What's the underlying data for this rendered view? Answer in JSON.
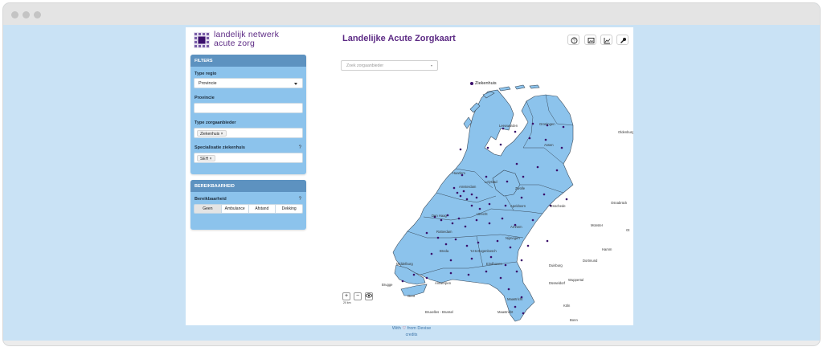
{
  "logo": {
    "line1": "landelijk netwerk",
    "line2": "acute zorg"
  },
  "app_title": "Landelijke Acute Zorgkaart",
  "filters": {
    "header": "FILTERS",
    "type_regio_label": "Type regio",
    "type_regio_value": "Provincie",
    "provincie_label": "Provincie",
    "provincie_value": "",
    "type_zorgaanbieder_label": "Type zorgaanbieder",
    "type_zorgaanbieder_tag": "Ziekenhuis",
    "specialisatie_label": "Specialisatie ziekenhuis",
    "specialisatie_tag": "SEH",
    "tag_remove": "×"
  },
  "bereikbaarheid": {
    "header": "BEREIKBAARHEID",
    "label": "Bereikbaarheid",
    "options": [
      "Geen",
      "Ambulance",
      "Afstand",
      "Dekking"
    ],
    "selected": "Geen"
  },
  "info_glyph": "?",
  "search": {
    "placeholder": "Zoek zorgaanbieder"
  },
  "legend": {
    "label": "Ziekenhuis",
    "color": "#3a0f6b"
  },
  "toolbar_icons": [
    "help-icon",
    "image-icon",
    "chart-icon",
    "wrench-icon"
  ],
  "map": {
    "land_color": "#8cc3ec",
    "cities_nl": [
      "Leeuwarden",
      "Groningen",
      "Assen",
      "Zwolle",
      "Lelystad",
      "Haarlem",
      "Amsterdam",
      "Utrecht",
      "Den Haag",
      "Rotterdam",
      "Arnhem",
      "Apeldoorn",
      "Enschede",
      "Arnhem",
      "Nijmegen",
      "'s-Hertogenbosch",
      "Eindhoven",
      "Middelburg",
      "Maastricht",
      "Breda",
      "Tilburg"
    ],
    "cities_out": [
      "Oldenburg",
      "Osnabrück",
      "Münster",
      "Hamm",
      "Dortmund",
      "Duisburg",
      "Wuppertal",
      "Düsseldorf",
      "Köln",
      "Bonn",
      "Brugge",
      "Antwerpen",
      "Gent",
      "Bruxelles - Brussel",
      "Mechelen"
    ],
    "zoom_in": "+",
    "zoom_out": "−",
    "scale_label": "20 km"
  },
  "footer": {
    "prefix": "With",
    "heart": "♡",
    "suffix": "from Devise",
    "credits": "credits"
  }
}
